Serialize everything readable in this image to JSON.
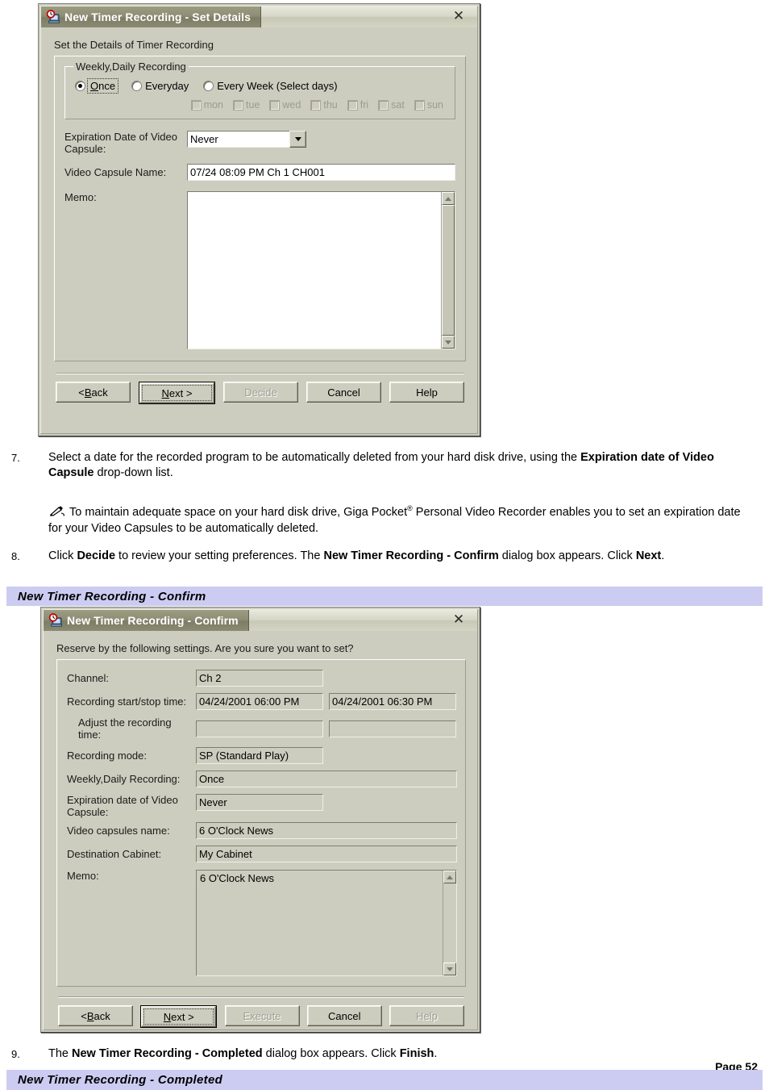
{
  "dialog1": {
    "title": "New Timer Recording - Set Details",
    "icon": "timer-recorder-icon",
    "close_label": "✕",
    "caption": "Set the Details of Timer Recording",
    "group_legend": "Weekly,Daily Recording",
    "radios": [
      {
        "label": "Once",
        "selected": true,
        "focused": true
      },
      {
        "label": "Everyday",
        "selected": false,
        "focused": false
      },
      {
        "label": "Every Week (Select days)",
        "selected": false,
        "focused": false
      }
    ],
    "days": [
      "mon",
      "tue",
      "wed",
      "thu",
      "fri",
      "sat",
      "sun"
    ],
    "expiration_label_1": "Expiration Date of Video",
    "expiration_label_2": "Capsule:",
    "expiration_value": "Never",
    "capsule_name_label": "Video Capsule Name:",
    "capsule_name_value": "07/24 08:09 PM Ch 1 CH001",
    "memo_label": "Memo:",
    "memo_value": "",
    "buttons": [
      {
        "label": "< Back",
        "state": "normal"
      },
      {
        "label": "Next >",
        "state": "default"
      },
      {
        "label": "Decide",
        "state": "disabled"
      },
      {
        "label": "Cancel",
        "state": "normal"
      },
      {
        "label": "Help",
        "state": "normal"
      }
    ]
  },
  "step7": {
    "number": "7.",
    "text_a": "Select a date for the recorded program to be automatically deleted from your hard disk drive, using the ",
    "bold_a": "Expiration date of Video Capsule",
    "text_b": " drop-down list."
  },
  "note": {
    "icon": "pencil-note-icon",
    "text_a": "To maintain adequate space on your hard disk drive, Giga Pocket",
    "sup": "®",
    "text_b": " Personal Video Recorder enables you to set an expiration date for your Video Capsules to be automatically deleted."
  },
  "step8": {
    "number": "8.",
    "text_a": "Click ",
    "bold_a": "Decide",
    "text_b": " to review your setting preferences. The ",
    "bold_b": "New Timer Recording - Confirm",
    "text_c": " dialog box appears. Click ",
    "bold_c": "Next",
    "text_d": "."
  },
  "section_confirm": {
    "label": "New Timer Recording - Confirm"
  },
  "dialog2": {
    "title": "New Timer Recording - Confirm",
    "icon": "timer-recorder-icon",
    "close_label": "✕",
    "caption": "Reserve by the following settings. Are you sure you want to set?",
    "rows": [
      {
        "label": "Channel:",
        "value": "Ch 2"
      },
      {
        "label": "Recording start/stop time:",
        "value": "04/24/2001 06:00 PM",
        "value2": "04/24/2001 06:30 PM"
      },
      {
        "label": "Adjust the recording time:",
        "value": "",
        "value2": ""
      },
      {
        "label": "Recording mode:",
        "value": "SP (Standard Play)"
      },
      {
        "label": "Weekly,Daily Recording:",
        "value": "Once"
      },
      {
        "label": "Expiration date of Video Capsule:",
        "value": "Never"
      },
      {
        "label": "Video capsules name:",
        "value": "6 O'Clock News"
      },
      {
        "label": "Destination Cabinet:",
        "value": "My Cabinet"
      }
    ],
    "expiration_label_1": "Expiration date of Video",
    "expiration_label_2": "Capsule:",
    "memo_label": "Memo:",
    "memo_value": "6 O'Clock News",
    "buttons": [
      {
        "label": "< Back",
        "state": "normal"
      },
      {
        "label": "Next >",
        "state": "default"
      },
      {
        "label": "Execute",
        "state": "disabled"
      },
      {
        "label": "Cancel",
        "state": "normal"
      },
      {
        "label": "Help",
        "state": "disabled"
      }
    ]
  },
  "step9": {
    "number": "9.",
    "text_a": "The ",
    "bold_a": "New Timer Recording - Completed",
    "text_b": " dialog box appears. Click ",
    "bold_b": "Finish",
    "text_c": "."
  },
  "page": {
    "label": "Page 52"
  },
  "section_completed": {
    "label": "New Timer Recording - Completed"
  },
  "colors": {
    "dialog_face": "#cdcdbf",
    "titlebar_active": "#8e8e76",
    "section_bar": "#ccccf2",
    "field_white": "#ffffff"
  }
}
